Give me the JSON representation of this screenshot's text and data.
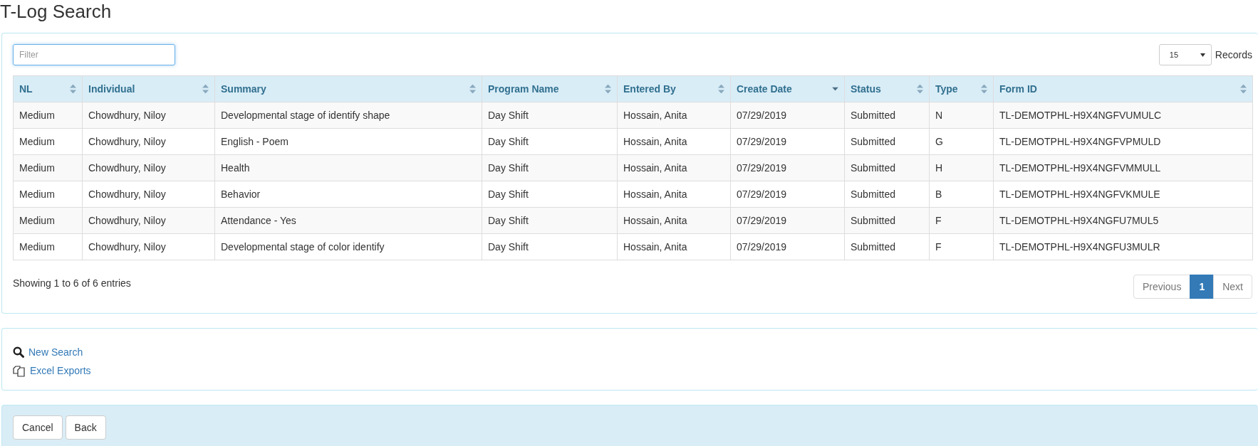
{
  "page_title": "T-Log Search",
  "filter": {
    "placeholder": "Filter"
  },
  "page_size": {
    "value": "15",
    "label": "Records"
  },
  "table": {
    "columns": [
      {
        "label": "NL",
        "sorted": false
      },
      {
        "label": "Individual",
        "sorted": false
      },
      {
        "label": "Summary",
        "sorted": false
      },
      {
        "label": "Program Name",
        "sorted": false
      },
      {
        "label": "Entered By",
        "sorted": false
      },
      {
        "label": "Create Date",
        "sorted": true
      },
      {
        "label": "Status",
        "sorted": false
      },
      {
        "label": "Type",
        "sorted": false
      },
      {
        "label": "Form ID",
        "sorted": false
      }
    ],
    "rows": [
      [
        "Medium",
        "Chowdhury, Niloy",
        "Developmental stage of identify shape",
        "Day Shift",
        "Hossain, Anita",
        "07/29/2019",
        "Submitted",
        "N",
        "TL-DEMOTPHL-H9X4NGFVUMULC"
      ],
      [
        "Medium",
        "Chowdhury, Niloy",
        "English - Poem",
        "Day Shift",
        "Hossain, Anita",
        "07/29/2019",
        "Submitted",
        "G",
        "TL-DEMOTPHL-H9X4NGFVPMULD"
      ],
      [
        "Medium",
        "Chowdhury, Niloy",
        "Health",
        "Day Shift",
        "Hossain, Anita",
        "07/29/2019",
        "Submitted",
        "H",
        "TL-DEMOTPHL-H9X4NGFVMMULL"
      ],
      [
        "Medium",
        "Chowdhury, Niloy",
        "Behavior",
        "Day Shift",
        "Hossain, Anita",
        "07/29/2019",
        "Submitted",
        "B",
        "TL-DEMOTPHL-H9X4NGFVKMULE"
      ],
      [
        "Medium",
        "Chowdhury, Niloy",
        "Attendance - Yes",
        "Day Shift",
        "Hossain, Anita",
        "07/29/2019",
        "Submitted",
        "F",
        "TL-DEMOTPHL-H9X4NGFU7MUL5"
      ],
      [
        "Medium",
        "Chowdhury, Niloy",
        "Developmental stage of color identify",
        "Day Shift",
        "Hossain, Anita",
        "07/29/2019",
        "Submitted",
        "F",
        "TL-DEMOTPHL-H9X4NGFU3MULR"
      ]
    ]
  },
  "info": "Showing 1 to 6 of 6 entries",
  "pagination": [
    {
      "label": "Previous",
      "selected": false,
      "disabled": true
    },
    {
      "label": "1",
      "selected": true,
      "disabled": false
    },
    {
      "label": "Next",
      "selected": false,
      "disabled": true
    }
  ],
  "actions": [
    {
      "label": "New Search",
      "kind": "search"
    },
    {
      "label": "Excel Exports",
      "kind": "export"
    }
  ],
  "buttons": [
    "Cancel",
    "Back"
  ]
}
